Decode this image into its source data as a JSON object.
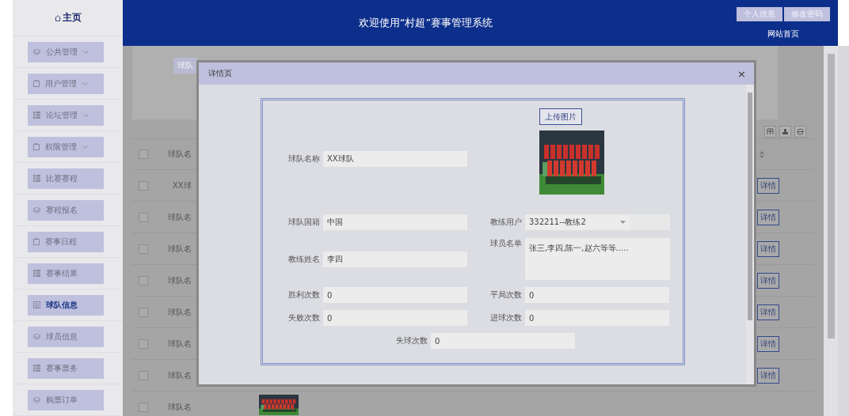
{
  "sidebar": {
    "home": "主页",
    "items": [
      {
        "label": "公共管理",
        "expandable": true,
        "selected": false
      },
      {
        "label": "用户管理",
        "expandable": true,
        "selected": false
      },
      {
        "label": "论坛管理",
        "expandable": true,
        "selected": false
      },
      {
        "label": "权限管理",
        "expandable": true,
        "selected": false
      },
      {
        "label": "比赛赛程",
        "expandable": false,
        "selected": false
      },
      {
        "label": "赛程报名",
        "expandable": false,
        "selected": false
      },
      {
        "label": "赛事日程",
        "expandable": false,
        "selected": false
      },
      {
        "label": "赛事结果",
        "expandable": false,
        "selected": false
      },
      {
        "label": "球队信息",
        "expandable": false,
        "selected": true
      },
      {
        "label": "球员信息",
        "expandable": false,
        "selected": false
      },
      {
        "label": "赛事票务",
        "expandable": false,
        "selected": false
      },
      {
        "label": "购票订单",
        "expandable": false,
        "selected": false
      }
    ]
  },
  "header": {
    "title": "欢迎使用“村超”赛事管理系统",
    "links": [
      "个人信息",
      "修改密码"
    ],
    "home_link": "网站首页"
  },
  "background": {
    "search_label": "球队",
    "table": {
      "header": "球队名",
      "header_checked": false,
      "rows": [
        {
          "name": "XX球",
          "action": "详情",
          "checked": false
        },
        {
          "name": "球队名",
          "action": "详情",
          "checked": false
        },
        {
          "name": "球队名",
          "action": "详情",
          "checked": false
        },
        {
          "name": "球队名",
          "action": "详情",
          "checked": false
        },
        {
          "name": "球队名",
          "action": "详情",
          "checked": false
        },
        {
          "name": "球队名",
          "action": "详情",
          "checked": false
        },
        {
          "name": "球队名",
          "action": "详情",
          "checked": false
        },
        {
          "name": "球队名",
          "checked": false
        }
      ]
    }
  },
  "modal": {
    "title": "详情页",
    "close": "×",
    "upload": "上传图片",
    "fields": [
      {
        "label": "球队名称",
        "kind": "text",
        "value": "XX球队"
      },
      {
        "label": "球队国籍",
        "kind": "text",
        "value": "中国"
      },
      {
        "label": "教练用户",
        "kind": "select",
        "value": "332211--教练2"
      },
      {
        "label": "教练姓名",
        "kind": "text",
        "value": "李四"
      },
      {
        "label": "球员名单",
        "kind": "textarea",
        "value": "张三,李四,陈一,赵六等等....."
      },
      {
        "label": "胜利次数",
        "kind": "text",
        "value": "0"
      },
      {
        "label": "平局次数",
        "kind": "text",
        "value": "0"
      },
      {
        "label": "失败次数",
        "kind": "text",
        "value": "0"
      },
      {
        "label": "进球次数",
        "kind": "text",
        "value": "0"
      },
      {
        "label": "失球次数",
        "kind": "text",
        "value": "0"
      }
    ]
  }
}
